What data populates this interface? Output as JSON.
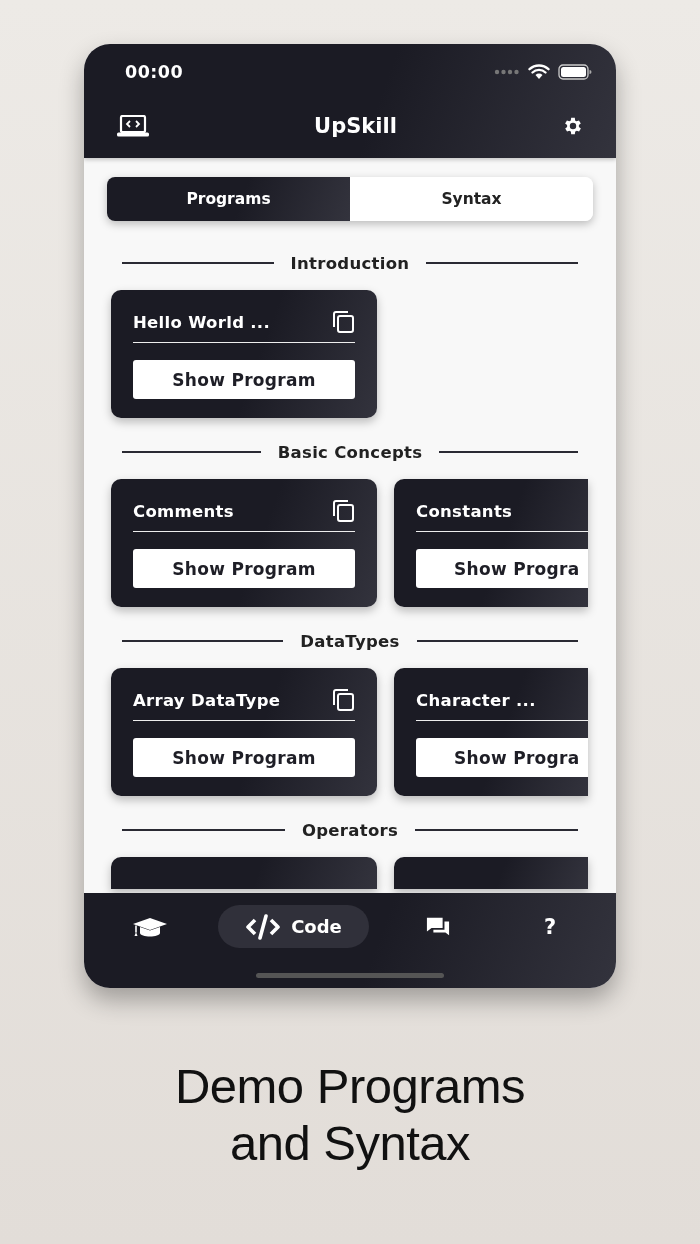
{
  "status_bar": {
    "time": "00:00"
  },
  "header": {
    "title": "UpSkill"
  },
  "segments": [
    {
      "label": "Programs",
      "selected": true
    },
    {
      "label": "Syntax",
      "selected": false
    }
  ],
  "sections": [
    {
      "title": "Introduction",
      "cards": [
        {
          "kind": "full",
          "title": "Hello World ...",
          "button": "Show Program"
        }
      ]
    },
    {
      "title": "Basic Concepts",
      "cards": [
        {
          "kind": "full",
          "title": "Comments",
          "button": "Show Program"
        },
        {
          "kind": "clipped",
          "title": "Constants",
          "button": "Show Progra"
        }
      ]
    },
    {
      "title": "DataTypes",
      "cards": [
        {
          "kind": "full",
          "title": "Array DataType",
          "button": "Show Program"
        },
        {
          "kind": "clipped",
          "title": "Character ...",
          "button": "Show Progra"
        }
      ]
    },
    {
      "title": "Operators",
      "cards": [
        {
          "kind": "peek"
        },
        {
          "kind": "peek-clipped"
        }
      ]
    }
  ],
  "tab_bar": [
    {
      "selected": false
    },
    {
      "label": "Code",
      "selected": true
    },
    {
      "selected": false
    },
    {
      "label": "?",
      "selected": false
    }
  ],
  "caption": "Demo Programs and Syntax"
}
